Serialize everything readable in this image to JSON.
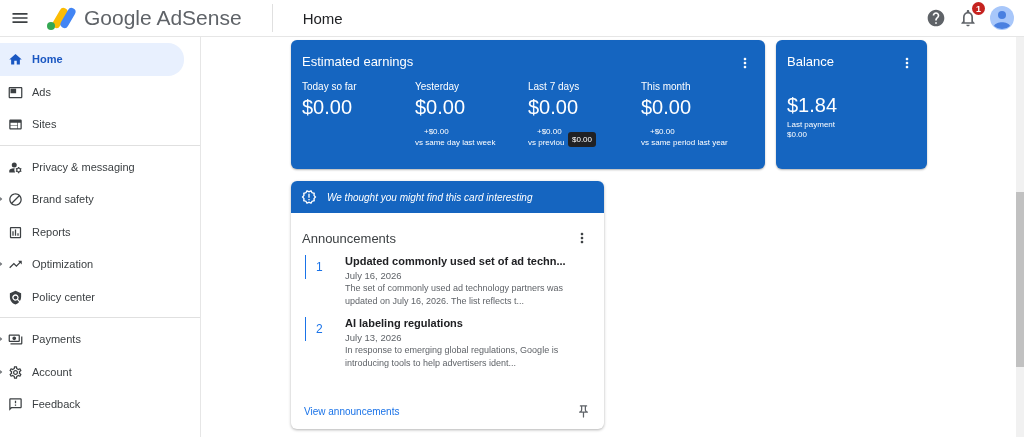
{
  "header": {
    "brand": "Google AdSense",
    "page_title": "Home",
    "notification_count": "1"
  },
  "sidebar": {
    "groups": [
      [
        {
          "label": "Home",
          "selected": true,
          "expandable": false
        },
        {
          "label": "Ads",
          "selected": false,
          "expandable": false
        },
        {
          "label": "Sites",
          "selected": false,
          "expandable": false
        }
      ],
      [
        {
          "label": "Privacy & messaging",
          "selected": false,
          "expandable": false
        },
        {
          "label": "Brand safety",
          "selected": false,
          "expandable": true
        },
        {
          "label": "Reports",
          "selected": false,
          "expandable": false
        },
        {
          "label": "Optimization",
          "selected": false,
          "expandable": true
        },
        {
          "label": "Policy center",
          "selected": false,
          "expandable": false
        }
      ],
      [
        {
          "label": "Payments",
          "selected": false,
          "expandable": true
        },
        {
          "label": "Account",
          "selected": false,
          "expandable": true
        },
        {
          "label": "Feedback",
          "selected": false,
          "expandable": false
        }
      ]
    ]
  },
  "earnings": {
    "title": "Estimated earnings",
    "periods": [
      {
        "label": "Today so far",
        "amount": "$0.00"
      },
      {
        "label": "Yesterday",
        "amount": "$0.00",
        "change": "+$0.00",
        "comparison": "vs same day last week"
      },
      {
        "label": "Last 7 days",
        "amount": "$0.00",
        "change": "+$0.00",
        "comparison": "vs previou",
        "tooltip": "$0.00"
      },
      {
        "label": "This month",
        "amount": "$0.00",
        "change": "+$0.00",
        "comparison": "vs same period last year"
      }
    ]
  },
  "balance": {
    "title": "Balance",
    "amount": "$1.84",
    "last_payment_label": "Last payment",
    "last_payment": "$0.00"
  },
  "suggestion_banner": "We thought you might find this card interesting",
  "announcements": {
    "title": "Announcements",
    "items": [
      {
        "number": "1",
        "title": "Updated commonly used set of ad techn...",
        "date": "July 16, 2026",
        "summary": "The set of commonly used ad technology partners was updated on July 16, 2026. The list reflects t..."
      },
      {
        "number": "2",
        "title": "AI labeling regulations",
        "date": "July 13, 2026",
        "summary": "In response to emerging global regulations, Google is introducing tools to help advertisers ident..."
      }
    ],
    "link": "View announcements"
  }
}
